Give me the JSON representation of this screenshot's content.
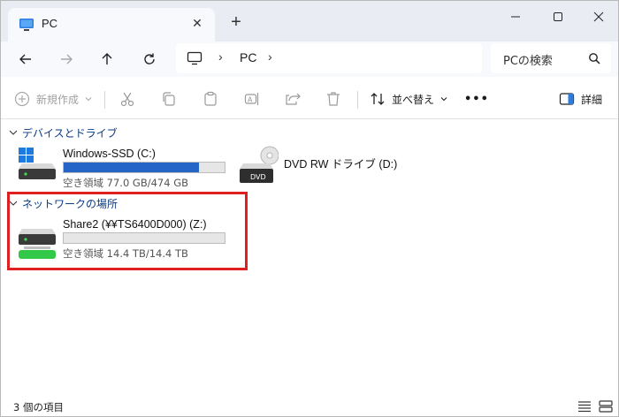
{
  "window": {
    "tab_title": "PC",
    "new_tab_label": "+",
    "tab_close_label": "✕"
  },
  "navigation": {
    "address_segment": "PC",
    "search_placeholder": "PCの検索"
  },
  "commands": {
    "new_label": "新規作成",
    "sort_label": "並べ替え",
    "more_label": "•••",
    "details_label": "詳細"
  },
  "groups": [
    {
      "title": "デバイスとドライブ",
      "drives": [
        {
          "name": "Windows-SSD (C:)",
          "subtitle": "空き領域 77.0 GB/474 GB",
          "used_fraction": 0.838,
          "bar_color": "#2665c8"
        },
        {
          "name": "DVD RW ドライブ (D:)",
          "badge": "DVD"
        }
      ]
    },
    {
      "title": "ネットワークの場所",
      "drives": [
        {
          "name": "Share2 (¥¥TS6400D000) (Z:)",
          "subtitle": "空き領域 14.4 TB/14.4 TB",
          "used_fraction": 0.0,
          "bar_color": "#2665c8"
        }
      ]
    }
  ],
  "status": {
    "item_count": "3 個の項目"
  },
  "colors": {
    "accent": "#2665c8",
    "highlight_border": "#e02020",
    "group_header": "#0b3a82"
  }
}
